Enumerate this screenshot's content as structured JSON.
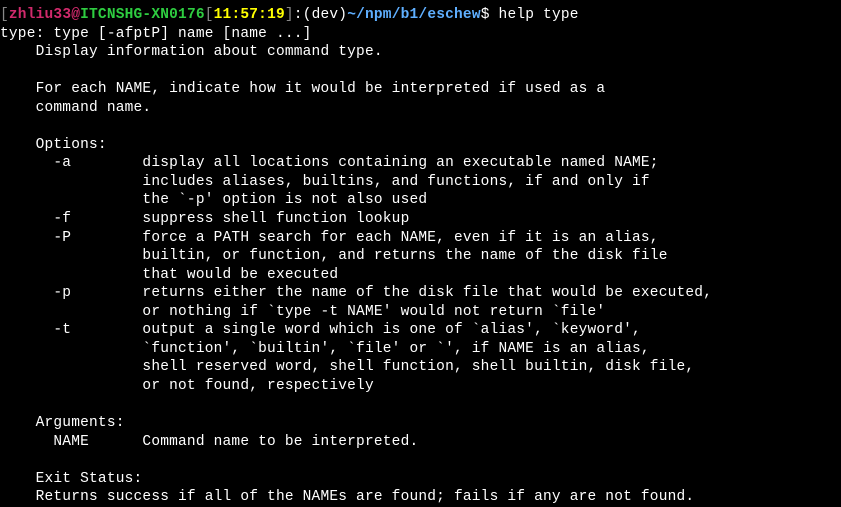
{
  "prompt": {
    "open_bracket": "[",
    "user": "zhliu33",
    "at": "@",
    "host": "ITCNSHG-XN0176",
    "open_bracket2": "[",
    "time": "11:57:19",
    "close_bracket2": "]",
    "sep": ":",
    "env": "(dev)",
    "path": "~/npm/b1/eschew",
    "dollar": "$ ",
    "command": "help type"
  },
  "output": {
    "line1": "type: type [-afptP] name [name ...]",
    "line2": "    Display information about command type.",
    "line3": "    ",
    "line4": "    For each NAME, indicate how it would be interpreted if used as a",
    "line5": "    command name.",
    "line6": "    ",
    "line7": "    Options:",
    "line8": "      -a        display all locations containing an executable named NAME;",
    "line9": "                includes aliases, builtins, and functions, if and only if",
    "line10": "                the `-p' option is not also used",
    "line11": "      -f        suppress shell function lookup",
    "line12": "      -P        force a PATH search for each NAME, even if it is an alias,",
    "line13": "                builtin, or function, and returns the name of the disk file",
    "line14": "                that would be executed",
    "line15": "      -p        returns either the name of the disk file that would be executed,",
    "line16": "                or nothing if `type -t NAME' would not return `file'",
    "line17": "      -t        output a single word which is one of `alias', `keyword',",
    "line18": "                `function', `builtin', `file' or `', if NAME is an alias,",
    "line19": "                shell reserved word, shell function, shell builtin, disk file,",
    "line20": "                or not found, respectively",
    "line21": "    ",
    "line22": "    Arguments:",
    "line23": "      NAME      Command name to be interpreted.",
    "line24": "    ",
    "line25": "    Exit Status:",
    "line26": "    Returns success if all of the NAMEs are found; fails if any are not found."
  }
}
